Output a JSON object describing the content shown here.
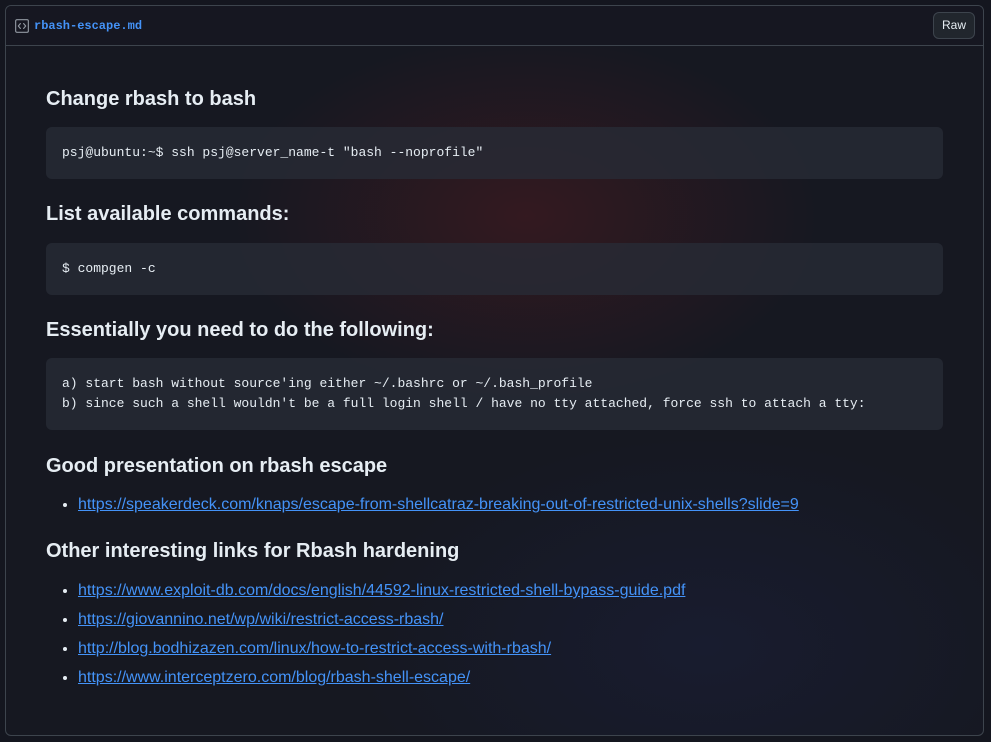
{
  "file": {
    "name": "rbash-escape.md",
    "raw_label": "Raw",
    "icon": "code-icon"
  },
  "sections": [
    {
      "heading": "Change rbash to bash",
      "code": "psj@ubuntu:~$ ssh psj@server_name-t \"bash --noprofile\""
    },
    {
      "heading": "List available commands:",
      "code": "$ compgen -c"
    },
    {
      "heading": "Essentially you need to do the following:",
      "code": "a) start bash without source'ing either ~/.bashrc or ~/.bash_profile\nb) since such a shell wouldn't be a full login shell / have no tty attached, force ssh to attach a tty:"
    },
    {
      "heading": "Good presentation on rbash escape",
      "links": [
        "https://speakerdeck.com/knaps/escape-from-shellcatraz-breaking-out-of-restricted-unix-shells?slide=9"
      ]
    },
    {
      "heading": "Other interesting links for Rbash hardening",
      "links": [
        "https://www.exploit-db.com/docs/english/44592-linux-restricted-shell-bypass-guide.pdf",
        "https://giovannino.net/wp/wiki/restrict-access-rbash/",
        "http://blog.bodhizazen.com/linux/how-to-restrict-access-with-rbash/",
        "https://www.interceptzero.com/blog/rbash-shell-escape/"
      ]
    }
  ],
  "colors": {
    "link": "#4493f8",
    "text": "#e6edf3",
    "border": "#3d444d"
  }
}
